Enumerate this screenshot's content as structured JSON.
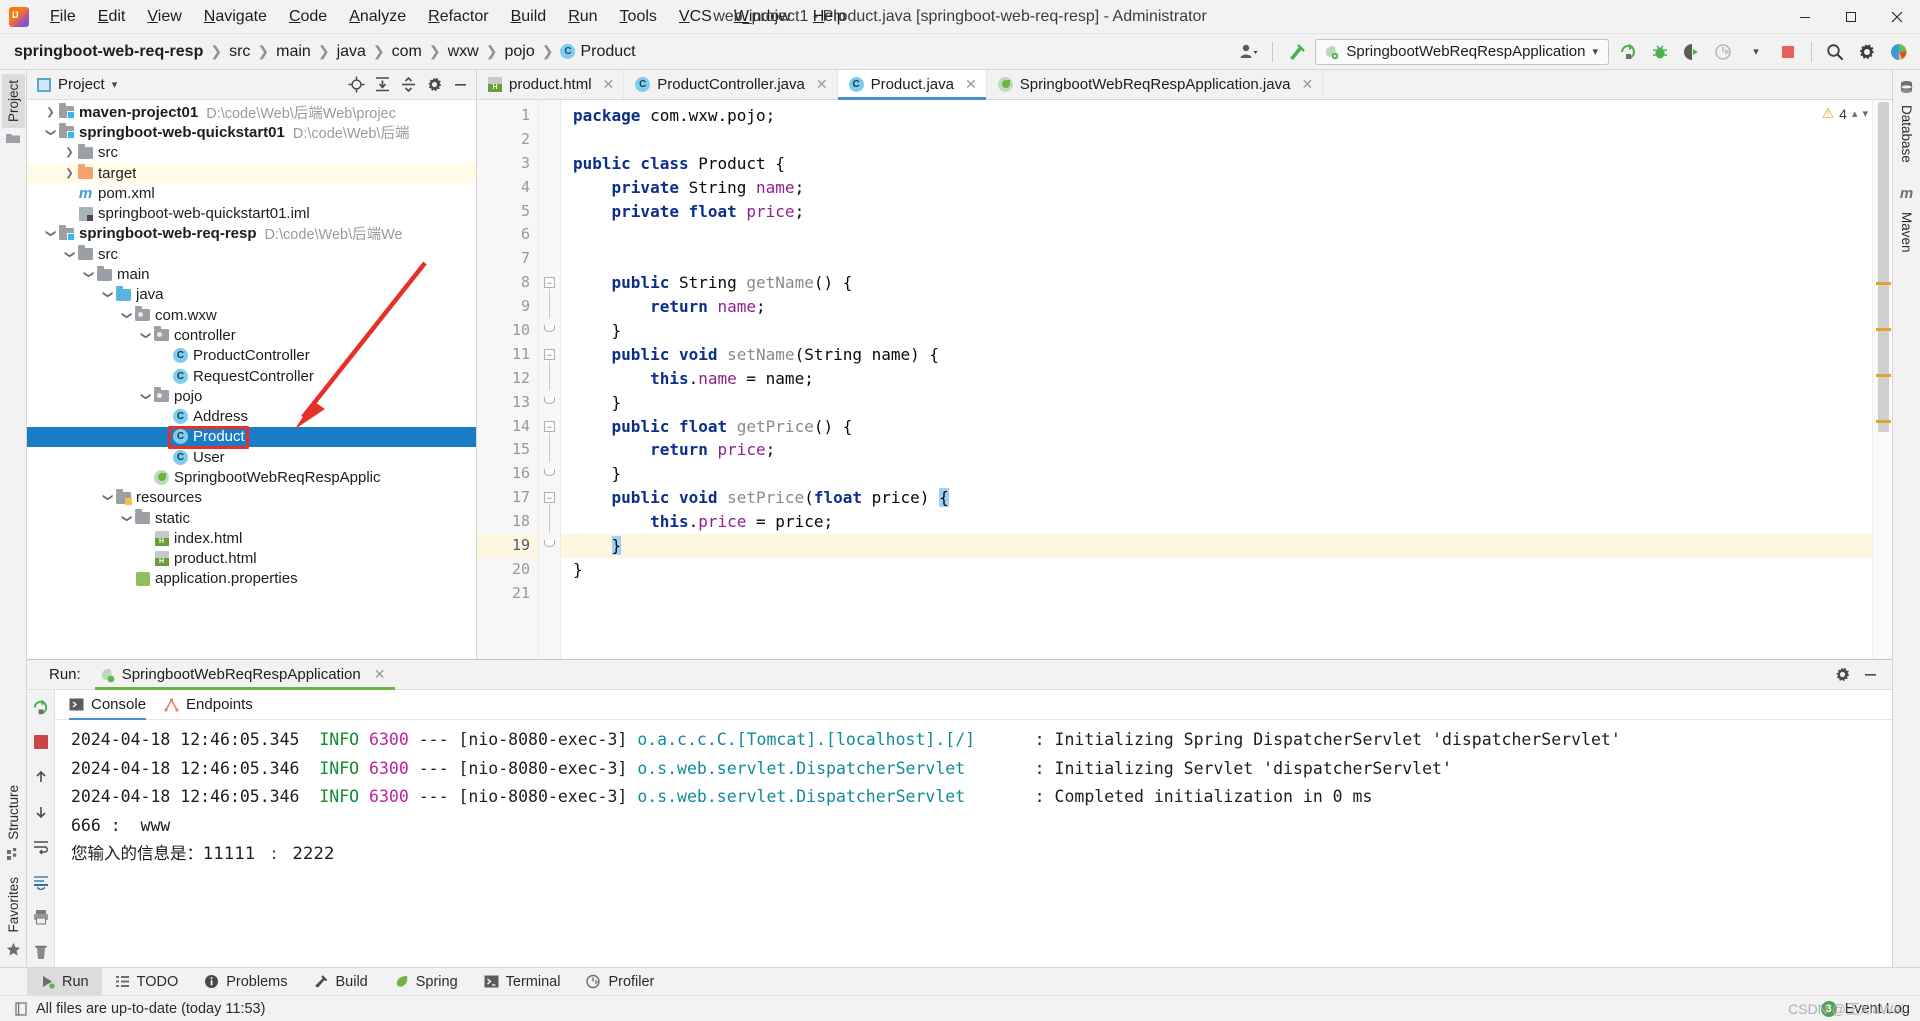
{
  "titlebar": {
    "logo": "intellij-logo",
    "menus": [
      "File",
      "Edit",
      "View",
      "Navigate",
      "Code",
      "Analyze",
      "Refactor",
      "Build",
      "Run",
      "Tools",
      "VCS",
      "Window",
      "Help"
    ],
    "window_title": "web_project1 - Product.java [springboot-web-req-resp] - Administrator",
    "minimize": "—",
    "maximize": "❐",
    "close": "✕"
  },
  "navbar": {
    "breadcrumbs": [
      "springboot-web-req-resp",
      "src",
      "main",
      "java",
      "com",
      "wxw",
      "pojo",
      "Product"
    ],
    "class_badge": "C",
    "run_config": "SpringbootWebReqRespApplication",
    "icons": [
      "user-icon",
      "build-hammer-icon",
      "rerun-icon",
      "debug-icon",
      "run-with-coverage-icon",
      "profiler-icon",
      "stop-icon",
      "search-icon",
      "gear-icon"
    ]
  },
  "rails": {
    "left_top": "Project",
    "left_bottom": [
      "Structure",
      "Favorites"
    ],
    "right": [
      "Database",
      "Maven"
    ]
  },
  "project_panel": {
    "title": "Project",
    "header_icons": [
      "locate-icon",
      "expand-all-icon",
      "collapse-all-icon",
      "gear-icon",
      "hide-icon"
    ],
    "tree": [
      {
        "indent": 0,
        "twisty": "collapsed",
        "icon": "module-folder",
        "label": "maven-project01",
        "bold": true,
        "path": "D:\\code\\Web\\后端Web\\projec",
        "state": "normal"
      },
      {
        "indent": 0,
        "twisty": "expanded",
        "icon": "module-folder",
        "label": "springboot-web-quickstart01",
        "bold": true,
        "path": "D:\\code\\Web\\后端",
        "state": "normal"
      },
      {
        "indent": 1,
        "twisty": "collapsed",
        "icon": "folder-gray",
        "label": "src",
        "bold": false,
        "path": "",
        "state": "normal"
      },
      {
        "indent": 1,
        "twisty": "collapsed",
        "icon": "folder-orange",
        "label": "target",
        "bold": false,
        "path": "",
        "state": "highlight"
      },
      {
        "indent": 1,
        "twisty": "none",
        "icon": "maven-m",
        "label": "pom.xml",
        "bold": false,
        "path": "",
        "state": "normal"
      },
      {
        "indent": 1,
        "twisty": "none",
        "icon": "iml-file",
        "label": "springboot-web-quickstart01.iml",
        "bold": false,
        "path": "",
        "state": "normal"
      },
      {
        "indent": 0,
        "twisty": "expanded",
        "icon": "module-folder",
        "label": "springboot-web-req-resp",
        "bold": true,
        "path": "D:\\code\\Web\\后端We",
        "state": "normal"
      },
      {
        "indent": 1,
        "twisty": "expanded",
        "icon": "folder-gray",
        "label": "src",
        "bold": false,
        "path": "",
        "state": "normal"
      },
      {
        "indent": 2,
        "twisty": "expanded",
        "icon": "folder-gray",
        "label": "main",
        "bold": false,
        "path": "",
        "state": "normal"
      },
      {
        "indent": 3,
        "twisty": "expanded",
        "icon": "folder-blue",
        "label": "java",
        "bold": false,
        "path": "",
        "state": "normal"
      },
      {
        "indent": 4,
        "twisty": "expanded",
        "icon": "package-folder",
        "label": "com.wxw",
        "bold": false,
        "path": "",
        "state": "normal"
      },
      {
        "indent": 5,
        "twisty": "expanded",
        "icon": "package-folder",
        "label": "controller",
        "bold": false,
        "path": "",
        "state": "normal"
      },
      {
        "indent": 6,
        "twisty": "none",
        "icon": "java-class",
        "label": "ProductController",
        "bold": false,
        "path": "",
        "state": "normal"
      },
      {
        "indent": 6,
        "twisty": "none",
        "icon": "java-class",
        "label": "RequestController",
        "bold": false,
        "path": "",
        "state": "normal"
      },
      {
        "indent": 5,
        "twisty": "expanded",
        "icon": "package-folder",
        "label": "pojo",
        "bold": false,
        "path": "",
        "state": "normal"
      },
      {
        "indent": 6,
        "twisty": "none",
        "icon": "java-class",
        "label": "Address",
        "bold": false,
        "path": "",
        "state": "normal"
      },
      {
        "indent": 6,
        "twisty": "none",
        "icon": "java-class",
        "label": "Product",
        "bold": false,
        "path": "",
        "state": "selected"
      },
      {
        "indent": 6,
        "twisty": "none",
        "icon": "java-class",
        "label": "User",
        "bold": false,
        "path": "",
        "state": "normal"
      },
      {
        "indent": 5,
        "twisty": "none",
        "icon": "spring-class",
        "label": "SpringbootWebReqRespApplic",
        "bold": false,
        "path": "",
        "state": "normal"
      },
      {
        "indent": 3,
        "twisty": "expanded",
        "icon": "resources-folder",
        "label": "resources",
        "bold": false,
        "path": "",
        "state": "normal"
      },
      {
        "indent": 4,
        "twisty": "expanded",
        "icon": "folder-gray",
        "label": "static",
        "bold": false,
        "path": "",
        "state": "normal"
      },
      {
        "indent": 5,
        "twisty": "none",
        "icon": "html-file",
        "label": "index.html",
        "bold": false,
        "path": "",
        "state": "normal"
      },
      {
        "indent": 5,
        "twisty": "none",
        "icon": "html-file",
        "label": "product.html",
        "bold": false,
        "path": "",
        "state": "normal"
      },
      {
        "indent": 4,
        "twisty": "none",
        "icon": "properties-file",
        "label": "application.properties",
        "bold": false,
        "path": "",
        "state": "normal"
      }
    ],
    "annotation": {
      "type": "red-box-and-arrow",
      "target": "Product",
      "color": "#e8302a"
    }
  },
  "editor": {
    "tabs": [
      {
        "label": "product.html",
        "icon": "html-file",
        "active": false
      },
      {
        "label": "ProductController.java",
        "icon": "java-class",
        "active": false
      },
      {
        "label": "Product.java",
        "icon": "java-class",
        "active": true
      },
      {
        "label": "SpringbootWebReqRespApplication.java",
        "icon": "spring-class",
        "active": false
      }
    ],
    "inspection": {
      "warning_count": "4",
      "warning_icon": "warning-triangle-icon"
    },
    "caret_line": 19,
    "lines": [
      {
        "n": 1,
        "fold": "",
        "tokens": [
          {
            "t": "package ",
            "c": "kw"
          },
          {
            "t": "com.wxw.pojo;",
            "c": "pl"
          }
        ]
      },
      {
        "n": 2,
        "fold": "",
        "tokens": []
      },
      {
        "n": 3,
        "fold": "",
        "tokens": [
          {
            "t": "public class ",
            "c": "kw"
          },
          {
            "t": "Product {",
            "c": "pl"
          }
        ]
      },
      {
        "n": 4,
        "fold": "",
        "tokens": [
          {
            "t": "    private ",
            "c": "kw"
          },
          {
            "t": "String ",
            "c": "pl"
          },
          {
            "t": "name",
            "c": "fld"
          },
          {
            "t": ";",
            "c": "pl"
          }
        ]
      },
      {
        "n": 5,
        "fold": "",
        "tokens": [
          {
            "t": "    private float ",
            "c": "kw"
          },
          {
            "t": "price",
            "c": "fld"
          },
          {
            "t": ";",
            "c": "pl"
          }
        ]
      },
      {
        "n": 6,
        "fold": "",
        "tokens": []
      },
      {
        "n": 7,
        "fold": "",
        "tokens": []
      },
      {
        "n": 8,
        "fold": "open",
        "tokens": [
          {
            "t": "    public ",
            "c": "kw"
          },
          {
            "t": "String ",
            "c": "pl"
          },
          {
            "t": "getName",
            "c": "mth"
          },
          {
            "t": "() {",
            "c": "pl"
          }
        ]
      },
      {
        "n": 9,
        "fold": "",
        "tokens": [
          {
            "t": "        return ",
            "c": "kw"
          },
          {
            "t": "name",
            "c": "fld"
          },
          {
            "t": ";",
            "c": "pl"
          }
        ]
      },
      {
        "n": 10,
        "fold": "close",
        "tokens": [
          {
            "t": "    }",
            "c": "pl"
          }
        ]
      },
      {
        "n": 11,
        "fold": "open",
        "tokens": [
          {
            "t": "    public void ",
            "c": "kw"
          },
          {
            "t": "setName",
            "c": "mth"
          },
          {
            "t": "(String name) {",
            "c": "pl"
          }
        ]
      },
      {
        "n": 12,
        "fold": "",
        "tokens": [
          {
            "t": "        this",
            "c": "kw"
          },
          {
            "t": ".",
            "c": "pl"
          },
          {
            "t": "name",
            "c": "fld"
          },
          {
            "t": " = name;",
            "c": "pl"
          }
        ]
      },
      {
        "n": 13,
        "fold": "close",
        "tokens": [
          {
            "t": "    }",
            "c": "pl"
          }
        ]
      },
      {
        "n": 14,
        "fold": "open",
        "tokens": [
          {
            "t": "    public float ",
            "c": "kw"
          },
          {
            "t": "getPrice",
            "c": "mth"
          },
          {
            "t": "() {",
            "c": "pl"
          }
        ]
      },
      {
        "n": 15,
        "fold": "",
        "tokens": [
          {
            "t": "        return ",
            "c": "kw"
          },
          {
            "t": "price",
            "c": "fld"
          },
          {
            "t": ";",
            "c": "pl"
          }
        ]
      },
      {
        "n": 16,
        "fold": "close",
        "tokens": [
          {
            "t": "    }",
            "c": "pl"
          }
        ]
      },
      {
        "n": 17,
        "fold": "open",
        "tokens": [
          {
            "t": "    public void ",
            "c": "kw"
          },
          {
            "t": "setPrice",
            "c": "mth"
          },
          {
            "t": "(",
            "c": "pl"
          },
          {
            "t": "float ",
            "c": "kw"
          },
          {
            "t": "price) ",
            "c": "pl"
          },
          {
            "t": "{",
            "c": "hl"
          }
        ]
      },
      {
        "n": 18,
        "fold": "",
        "tokens": [
          {
            "t": "        this",
            "c": "kw"
          },
          {
            "t": ".",
            "c": "pl"
          },
          {
            "t": "price",
            "c": "fld"
          },
          {
            "t": " = price;",
            "c": "pl"
          }
        ]
      },
      {
        "n": 19,
        "fold": "close",
        "tokens": [
          {
            "t": "    ",
            "c": "pl"
          },
          {
            "t": "}",
            "c": "hl"
          }
        ]
      },
      {
        "n": 20,
        "fold": "",
        "tokens": [
          {
            "t": "}",
            "c": "pl"
          }
        ]
      },
      {
        "n": 21,
        "fold": "",
        "tokens": []
      }
    ]
  },
  "run_panel": {
    "label": "Run:",
    "tab": "SpringbootWebReqRespApplication",
    "tab_icon": "spring-run-icon",
    "close_icon": "✕",
    "header_icons": [
      "gear-icon",
      "hide-icon"
    ],
    "gutter_icons": [
      "rerun-icon",
      "stop-icon",
      "scroll-up-icon",
      "scroll-down-icon",
      "soft-wrap-icon",
      "scroll-to-end-icon",
      "print-icon",
      "clear-all-icon"
    ],
    "subtabs": [
      {
        "label": "Console",
        "icon": "console-icon",
        "active": true
      },
      {
        "label": "Endpoints",
        "icon": "endpoints-icon",
        "active": false
      }
    ],
    "log": [
      {
        "type": "spring",
        "ts": "2024-04-18 12:46:05.345",
        "level": "INFO",
        "pid": "6300",
        "dash": "---",
        "thread": "[nio-8080-exec-3]",
        "logger": "o.a.c.c.C.[Tomcat].[localhost].[/]",
        "logger_pad": 40,
        "msg": ": Initializing Spring DispatcherServlet 'dispatcherServlet'"
      },
      {
        "type": "spring",
        "ts": "2024-04-18 12:46:05.346",
        "level": "INFO",
        "pid": "6300",
        "dash": "---",
        "thread": "[nio-8080-exec-3]",
        "logger": "o.s.web.servlet.DispatcherServlet",
        "logger_pad": 40,
        "msg": ": Initializing Servlet 'dispatcherServlet'"
      },
      {
        "type": "spring",
        "ts": "2024-04-18 12:46:05.346",
        "level": "INFO",
        "pid": "6300",
        "dash": "---",
        "thread": "[nio-8080-exec-3]",
        "logger": "o.s.web.servlet.DispatcherServlet",
        "logger_pad": 40,
        "msg": ": Completed initialization in 0 ms"
      },
      {
        "type": "plain",
        "text": "666 :  www"
      },
      {
        "type": "plain_cn",
        "text": "您输入的信息是：11111   :   2222"
      }
    ]
  },
  "bottom_tools": [
    {
      "label": "Run",
      "icon": "run-icon",
      "active": true
    },
    {
      "label": "TODO",
      "icon": "todo-icon",
      "active": false
    },
    {
      "label": "Problems",
      "icon": "problems-icon",
      "active": false
    },
    {
      "label": "Build",
      "icon": "build-hammer-icon",
      "active": false
    },
    {
      "label": "Spring",
      "icon": "spring-leaf-icon",
      "active": false
    },
    {
      "label": "Terminal",
      "icon": "terminal-icon",
      "active": false
    },
    {
      "label": "Profiler",
      "icon": "profiler-icon",
      "active": false
    }
  ],
  "statusbar": {
    "icon": "document-icon",
    "message": "All files are up-to-date (today 11:53)",
    "event_log": "Event Log",
    "event_count": "3"
  },
  "watermark": "CSDN @王XiaWei",
  "colors": {
    "accent": "#4a90d9",
    "selection": "#1a7cc4",
    "annotation": "#e8302a",
    "spring_green": "#6db33f",
    "caret_line": "#fdf7e2",
    "keyword": "#0b2f8a",
    "field": "#8f1f8f",
    "method": "#8a8a8a",
    "log_info": "#0f8c2e",
    "log_pid": "#c0219e",
    "log_logger": "#108a9c"
  }
}
